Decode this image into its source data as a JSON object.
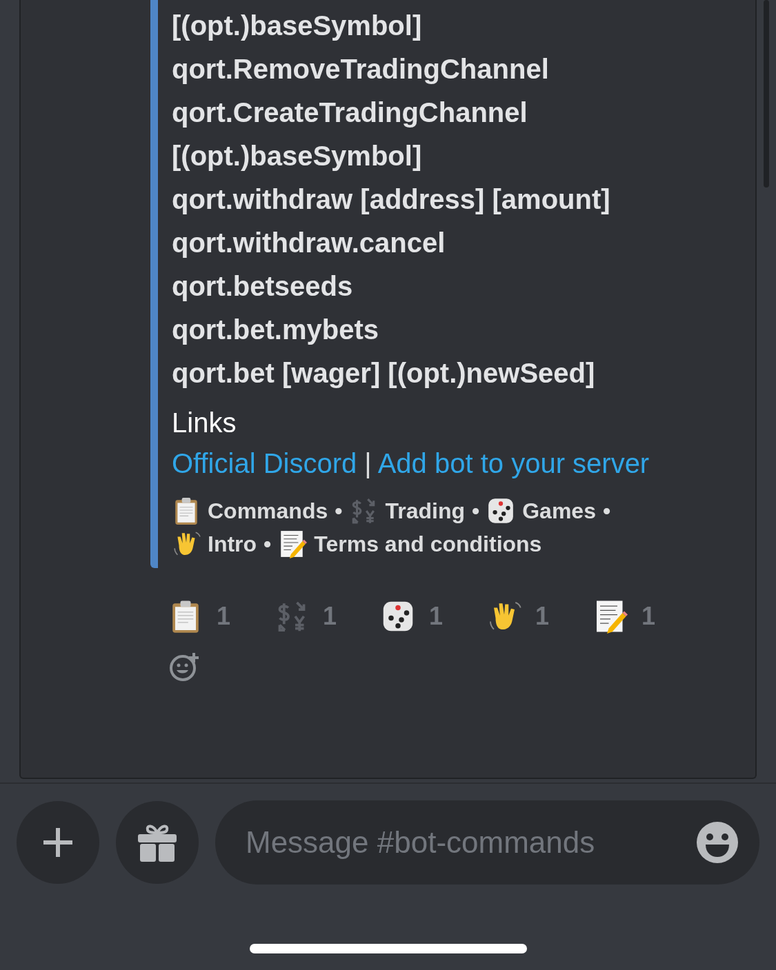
{
  "embed": {
    "command_lines": [
      "[(opt.)baseSymbol]",
      "qort.RemoveTradingChannel",
      "qort.CreateTradingChannel",
      "[(opt.)baseSymbol]",
      "qort.withdraw [address] [amount]",
      "qort.withdraw.cancel",
      "qort.betseeds",
      "qort.bet.mybets",
      "qort.bet [wager] [(opt.)newSeed]"
    ],
    "links_heading": "Links",
    "links": [
      {
        "label": "Official Discord",
        "separator": "|"
      },
      {
        "label": "Add bot to your server"
      }
    ],
    "footer_items": [
      {
        "label": "Commands"
      },
      {
        "label": "Trading"
      },
      {
        "label": "Games"
      },
      {
        "label": "Intro"
      },
      {
        "label": "Terms and conditions"
      }
    ],
    "footer_separator": "•"
  },
  "reactions": [
    {
      "count": "1"
    },
    {
      "count": "1"
    },
    {
      "count": "1"
    },
    {
      "count": "1"
    },
    {
      "count": "1"
    }
  ],
  "composer": {
    "placeholder": "Message #bot-commands"
  }
}
